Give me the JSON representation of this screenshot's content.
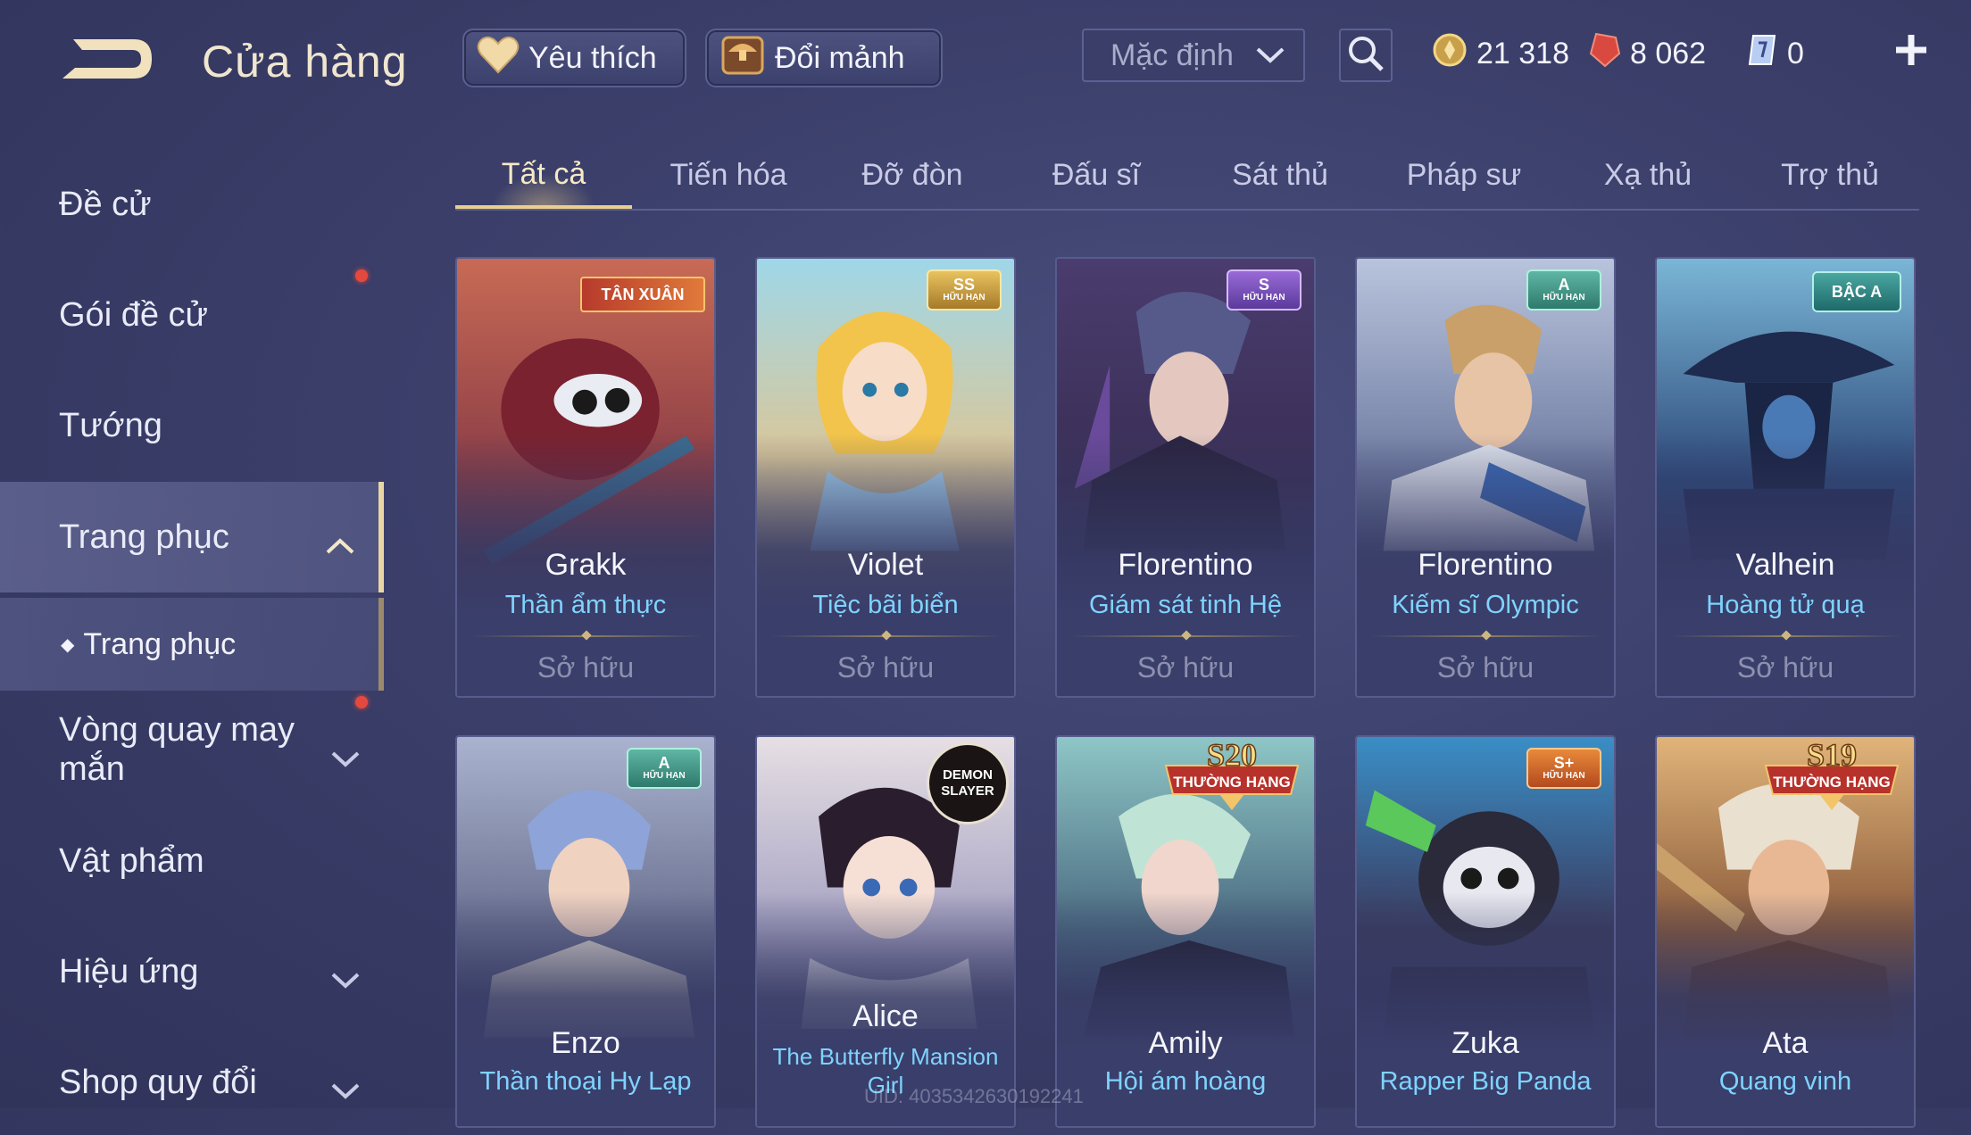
{
  "header": {
    "title": "Cửa hàng",
    "favorite_label": "Yêu thích",
    "exchange_label": "Đổi mảnh",
    "sort_value": "Mặc định",
    "currencies": [
      {
        "name": "gold",
        "value": "21 318"
      },
      {
        "name": "ruby",
        "value": "8 062"
      },
      {
        "name": "gem",
        "value": "0"
      }
    ]
  },
  "sidebar": {
    "items": [
      {
        "label": "Đề cử"
      },
      {
        "label": "Gói đề cử"
      },
      {
        "label": "Tướng"
      },
      {
        "label": "Trang phục"
      },
      {
        "label": "Trang phục"
      },
      {
        "label": "Vòng quay may mắn"
      },
      {
        "label": "Vật phẩm"
      },
      {
        "label": "Hiệu ứng"
      },
      {
        "label": "Shop quy đổi"
      }
    ]
  },
  "tabs": [
    {
      "label": "Tất cả"
    },
    {
      "label": "Tiến hóa"
    },
    {
      "label": "Đỡ đòn"
    },
    {
      "label": "Đấu sĩ"
    },
    {
      "label": "Sát thủ"
    },
    {
      "label": "Pháp sư"
    },
    {
      "label": "Xạ thủ"
    },
    {
      "label": "Trợ thủ"
    }
  ],
  "cards": [
    {
      "hero": "Grakk",
      "skin": "Thần ẩm thực",
      "status": "Sở hữu",
      "badge": "TÂN XUÂN"
    },
    {
      "hero": "Violet",
      "skin": "Tiệc bãi biển",
      "status": "Sở hữu",
      "badge": "SS",
      "badge_sub": "HỮU HẠN"
    },
    {
      "hero": "Florentino",
      "skin": "Giám sát tinh Hệ",
      "status": "Sở hữu",
      "badge": "S",
      "badge_sub": "HỮU HẠN"
    },
    {
      "hero": "Florentino",
      "skin": "Kiếm sĩ Olympic",
      "status": "Sở hữu",
      "badge": "A",
      "badge_sub": "HỮU HẠN"
    },
    {
      "hero": "Valhein",
      "skin": "Hoàng tử quạ",
      "status": "Sở hữu",
      "badge": "BẬC A"
    },
    {
      "hero": "Enzo",
      "skin": "Thần thoại Hy Lạp",
      "badge": "A",
      "badge_sub": "HỮU HẠN"
    },
    {
      "hero": "Alice",
      "skin": "The Butterfly Mansion Girl",
      "badge": "DEMON SLAYER"
    },
    {
      "hero": "Amily",
      "skin": "Hội ám hoàng",
      "badge": "S20",
      "badge_sub": "THƯỜNG HẠNG"
    },
    {
      "hero": "Zuka",
      "skin": "Rapper Big Panda",
      "badge": "S+",
      "badge_sub": "HỮU HẠN"
    },
    {
      "hero": "Ata",
      "skin": "Quang vinh",
      "badge": "S19",
      "badge_sub": "THƯỜNG HẠNG"
    }
  ],
  "footer": {
    "uid": "UID: 4035342630192241"
  },
  "colors": {
    "accent_gold": "#e7cf8e",
    "skin_name": "#7fd3ff",
    "background": "#3b3f6a",
    "red_dot": "#e3493f"
  }
}
